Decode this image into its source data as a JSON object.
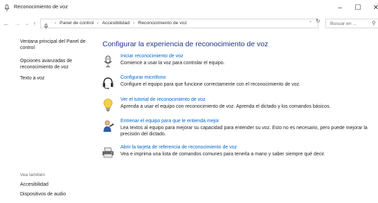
{
  "window": {
    "title": "Reconocimiento de voz",
    "minimize_glyph": "–",
    "maximize_glyph": "☐",
    "close_glyph": "✕"
  },
  "nav": {
    "back_glyph": "←",
    "forward_glyph": "→",
    "recent_glyph": "⌄",
    "up_glyph": "↑",
    "breadcrumbs": [
      "Panel de control",
      "Accesibilidad",
      "Reconocimiento de voz"
    ],
    "separator": "›",
    "dropdown_glyph": "⌄",
    "refresh_glyph": "↻",
    "search_placeholder": "Buscar en ...",
    "search_glyph": "⚲"
  },
  "sidebar": {
    "links": [
      "Ventana principal del Panel de control",
      "Opciones avanzadas de reconocimiento de voz",
      "Texto a voz"
    ],
    "see_also_heading": "Vea también",
    "see_also": [
      "Accesibilidad",
      "Dispositivos de audio"
    ]
  },
  "main": {
    "title": "Configurar la experiencia de reconocimiento de voz",
    "items": [
      {
        "link": "Iniciar reconocimiento de voz",
        "desc": "Comience a usar la voz para controlar el equipo.",
        "icon": "microphone-icon"
      },
      {
        "link": "Configurar micrófono",
        "desc": "Configure el equipo para que funcione correctamente con el reconocimiento de voz.",
        "icon": "headset-icon"
      },
      {
        "link": "Ver el tutorial de reconocimiento de voz",
        "desc": "Aprenda a usar el equipo con reconocimiento de voz. Aprenda el dictado y los comandos básicos.",
        "icon": "lightbulb-icon"
      },
      {
        "link": "Entrenar el equipo para que le entienda mejor",
        "desc": "Lea textos al equipo para mejorar su capacidad para entender su voz. Esto no es necesario, pero puede mejorar la precisión del dictado.",
        "icon": "person-icon"
      },
      {
        "link": "Abrir la tarjeta de referencia de reconocimiento de voz",
        "desc": "Vea e imprima una lista de comandos comunes para tenerla a mano y saber siempre qué decir.",
        "icon": "printer-icon"
      }
    ]
  },
  "colors": {
    "title_blue": "#1e3287",
    "link_blue": "#0066cc"
  }
}
